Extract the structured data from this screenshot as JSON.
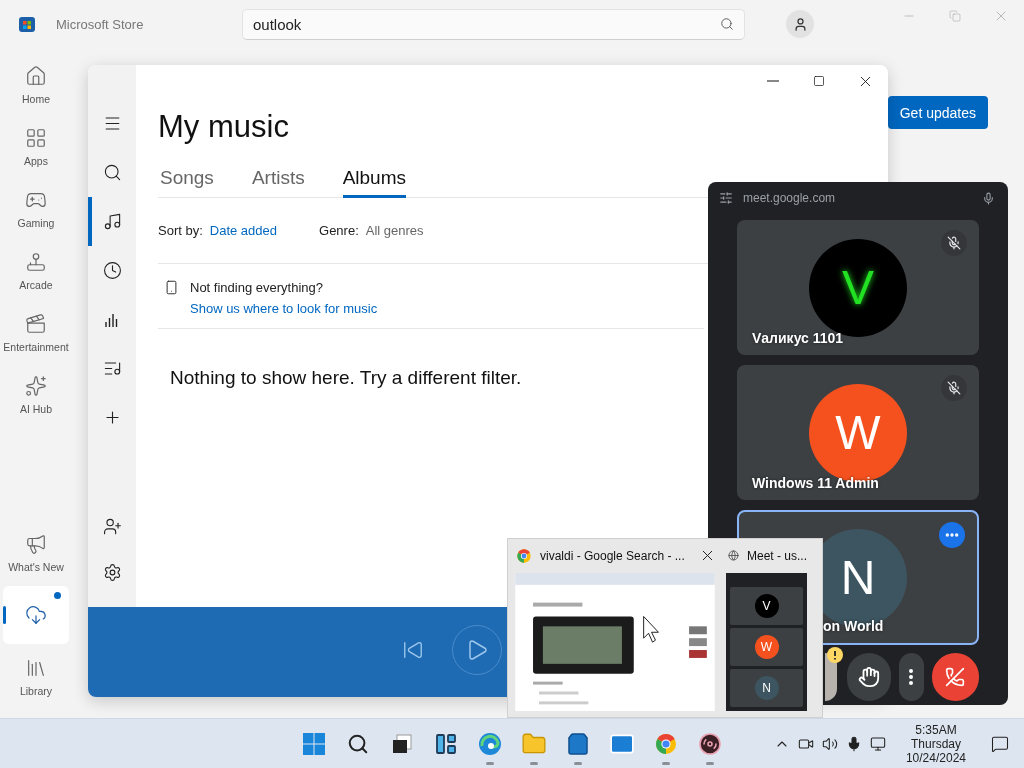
{
  "store": {
    "title": "Microsoft Store",
    "search": {
      "value": "outlook"
    },
    "nav": [
      {
        "kind": "home",
        "label": "Home",
        "selected": false
      },
      {
        "kind": "apps",
        "label": "Apps",
        "selected": false
      },
      {
        "kind": "gaming",
        "label": "Gaming",
        "selected": false
      },
      {
        "kind": "arcade",
        "label": "Arcade",
        "selected": false
      },
      {
        "kind": "entertainment",
        "label": "Entertainment",
        "selected": false
      },
      {
        "kind": "ai",
        "label": "AI Hub",
        "selected": false
      }
    ],
    "nav_bottom": [
      {
        "kind": "news",
        "label": "What's New",
        "selected": false,
        "badge": false
      },
      {
        "kind": "downloads",
        "selected": true,
        "badge": true
      },
      {
        "kind": "library",
        "label": "Library",
        "selected": false,
        "badge": false
      }
    ],
    "get_updates": "Get updates"
  },
  "music": {
    "title": "My music",
    "rail": [
      {
        "kind": "menu",
        "selected": false
      },
      {
        "kind": "search",
        "selected": false
      },
      {
        "kind": "music",
        "selected": true
      },
      {
        "kind": "recent",
        "selected": false
      },
      {
        "kind": "charts",
        "selected": false
      },
      {
        "kind": "playlist",
        "selected": false
      },
      {
        "kind": "add",
        "selected": false
      }
    ],
    "rail_bottom": [
      {
        "kind": "account",
        "selected": false
      },
      {
        "kind": "settings",
        "selected": false
      }
    ],
    "tabs": [
      {
        "label": "Songs",
        "selected": false
      },
      {
        "label": "Artists",
        "selected": false
      },
      {
        "label": "Albums",
        "selected": true
      }
    ],
    "sort_label": "Sort by:",
    "sort_value": "Date added",
    "genre_label": "Genre:",
    "genre_value": "All genres",
    "notice": "Not finding everything?",
    "notice_link": "Show us where to look for music",
    "empty": "Nothing to show here. Try a different filter."
  },
  "meet": {
    "url": "meet.google.com",
    "participants": [
      {
        "name": "Vаликус 1101",
        "initial": "V",
        "kind": "neon",
        "color": "#000000",
        "muted": true,
        "selected": false
      },
      {
        "name": "Windows 11 Admin",
        "initial": "W",
        "kind": "plain",
        "color": "#f4511e",
        "muted": true,
        "selected": false
      },
      {
        "name": "on World",
        "initial": "N",
        "kind": "plain",
        "color": "#3d5560",
        "muted": false,
        "selected": true
      }
    ]
  },
  "preview": {
    "thumbnails": [
      {
        "kind": "browser",
        "title": "vivaldi - Google Search - ...",
        "selected": true
      },
      {
        "kind": "meet",
        "title": "Meet - us...",
        "selected": false,
        "tiles": [
          {
            "initial": "V",
            "color": "#000000"
          },
          {
            "initial": "W",
            "color": "#f4511e"
          },
          {
            "initial": "N",
            "color": "#3d5560"
          }
        ]
      }
    ]
  },
  "taskbar": {
    "apps": [
      {
        "kind": "start",
        "running": false
      },
      {
        "kind": "search",
        "running": false
      },
      {
        "kind": "taskview",
        "running": false
      },
      {
        "kind": "widgets",
        "running": false
      },
      {
        "kind": "edge",
        "running": true
      },
      {
        "kind": "explorer",
        "running": true
      },
      {
        "kind": "store",
        "running": true
      },
      {
        "kind": "mail",
        "running": false
      },
      {
        "kind": "chrome",
        "running": true
      },
      {
        "kind": "player",
        "running": true
      }
    ],
    "tray": [
      {
        "kind": "chevron"
      },
      {
        "kind": "camera"
      },
      {
        "kind": "volume"
      },
      {
        "kind": "mic"
      },
      {
        "kind": "network"
      }
    ],
    "time": "5:35AM",
    "day": "Thursday",
    "date": "10/24/2024"
  }
}
